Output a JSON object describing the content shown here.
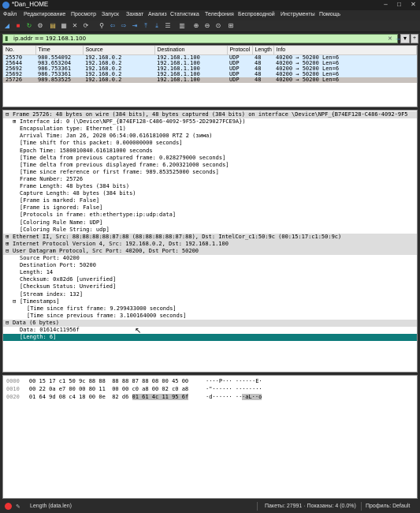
{
  "window": {
    "title": "*Dan_HOME",
    "minimize": "–",
    "maximize": "□",
    "close": "✕"
  },
  "menu": [
    "Файл",
    "Редактирование",
    "Просмотр",
    "Запуск",
    "Захват",
    "Анализ",
    "Статистика",
    "Телефония",
    "Беспроводной",
    "Инструменты",
    "Помощь"
  ],
  "toolbar": {
    "icons": [
      "shark-fin-start-icon",
      "stop-icon",
      "restart-icon",
      "options-gear-icon",
      "open-file-icon",
      "save-icon",
      "close-file-icon",
      "reload-icon",
      "find-icon",
      "back-icon",
      "forward-icon",
      "go-to-packet-icon",
      "first-packet-icon",
      "last-packet-icon",
      "autoscroll-icon",
      "colorize-icon",
      "zoom-in-icon",
      "zoom-out-icon",
      "zoom-reset-icon",
      "resize-columns-icon"
    ]
  },
  "filter": {
    "value": "ip.addr == 192.168.1.100",
    "apply_label": "→",
    "add_label": "+"
  },
  "packet_list": {
    "columns": [
      "No.",
      "Time",
      "Source",
      "Destination",
      "Protocol",
      "Length",
      "Info"
    ],
    "rows": [
      [
        "25570",
        "980.554092",
        "192.168.0.2",
        "192.168.1.100",
        "UDP",
        "48",
        "40200 → 50200 Len=6"
      ],
      [
        "25644",
        "983.653204",
        "192.168.0.2",
        "192.168.1.100",
        "UDP",
        "48",
        "40200 → 50200 Len=6"
      ],
      [
        "25692",
        "986.753361",
        "192.168.0.2",
        "192.168.1.100",
        "UDP",
        "48",
        "40200 → 50200 Len=6"
      ],
      [
        "25692",
        "986.753361",
        "192.168.0.2",
        "192.168.1.100",
        "UDP",
        "48",
        "40200 → 50200 Len=6"
      ],
      [
        "25726",
        "989.853525",
        "192.168.0.2",
        "192.168.1.100",
        "UDP",
        "48",
        "40200 → 50200 Len=6"
      ]
    ],
    "selected_index": 4
  },
  "details": [
    {
      "indent": 0,
      "exp": "⊟",
      "text": "Frame 25726: 48 bytes on wire (384 bits), 48 bytes captured (384 bits) on interface \\Device\\NPF_{B74EF128-C486-4092-9F5",
      "style": "hdr"
    },
    {
      "indent": 1,
      "exp": "⊞",
      "text": "Interface id: 0 (\\Device\\NPF_{B74EF128-C486-4092-9F55-2D29027FCE9A})"
    },
    {
      "indent": 1,
      "exp": "",
      "text": "Encapsulation type: Ethernet (1)"
    },
    {
      "indent": 1,
      "exp": "",
      "text": "Arrival Time: Jan 26, 2020 06:54:00.616181000 RTZ 2 (зима)"
    },
    {
      "indent": 1,
      "exp": "",
      "text": "[Time shift for this packet: 0.000000000 seconds]"
    },
    {
      "indent": 1,
      "exp": "",
      "text": "Epoch Time: 1580010840.616181000 seconds"
    },
    {
      "indent": 1,
      "exp": "",
      "text": "[Time delta from previous captured frame: 0.028279000 seconds]"
    },
    {
      "indent": 1,
      "exp": "",
      "text": "[Time delta from previous displayed frame: 6.200321000 seconds]"
    },
    {
      "indent": 1,
      "exp": "",
      "text": "[Time since reference or first frame: 989.853525000 seconds]"
    },
    {
      "indent": 1,
      "exp": "",
      "text": "Frame Number: 25726"
    },
    {
      "indent": 1,
      "exp": "",
      "text": "Frame Length: 48 bytes (384 bits)"
    },
    {
      "indent": 1,
      "exp": "",
      "text": "Capture Length: 48 bytes (384 bits)"
    },
    {
      "indent": 1,
      "exp": "",
      "text": "[Frame is marked: False]"
    },
    {
      "indent": 1,
      "exp": "",
      "text": "[Frame is ignored: False]"
    },
    {
      "indent": 1,
      "exp": "",
      "text": "[Protocols in frame: eth:ethertype:ip:udp:data]"
    },
    {
      "indent": 1,
      "exp": "",
      "text": "[Coloring Rule Name: UDP]"
    },
    {
      "indent": 1,
      "exp": "",
      "text": "[Coloring Rule String: udp]"
    },
    {
      "indent": 0,
      "exp": "⊞",
      "text": "Ethernet II, Src: 88:88:88:88:87:88 (88:88:88:88:87:88), Dst: IntelCor_c1:50:9c (00:15:17:c1:50:9c)",
      "style": "hdr"
    },
    {
      "indent": 0,
      "exp": "⊞",
      "text": "Internet Protocol Version 4, Src: 192.168.0.2, Dst: 192.168.1.100",
      "style": "hdr"
    },
    {
      "indent": 0,
      "exp": "⊟",
      "text": "User Datagram Protocol, Src Port: 40200, Dst Port: 50200",
      "style": "hdr"
    },
    {
      "indent": 1,
      "exp": "",
      "text": "Source Port: 40200"
    },
    {
      "indent": 1,
      "exp": "",
      "text": "Destination Port: 50200"
    },
    {
      "indent": 1,
      "exp": "",
      "text": "Length: 14"
    },
    {
      "indent": 1,
      "exp": "",
      "text": "Checksum: 0x82d6 [unverified]"
    },
    {
      "indent": 1,
      "exp": "",
      "text": "[Checksum Status: Unverified]"
    },
    {
      "indent": 1,
      "exp": "",
      "text": "[Stream index: 132]"
    },
    {
      "indent": 1,
      "exp": "⊟",
      "text": "[Timestamps]"
    },
    {
      "indent": 2,
      "exp": "",
      "text": "[Time since first frame: 9.299433000 seconds]"
    },
    {
      "indent": 2,
      "exp": "",
      "text": "[Time since previous frame: 3.100164000 seconds]"
    },
    {
      "indent": 0,
      "exp": "⊟",
      "text": "Data (6 bytes)",
      "style": "hdr"
    },
    {
      "indent": 1,
      "exp": "",
      "text": "Data: 01614c11956f"
    },
    {
      "indent": 1,
      "exp": "",
      "text": "[Length: 6]",
      "style": "sel"
    }
  ],
  "bytes": [
    {
      "offset": "0000",
      "hex_a": "00 15 17 c1 50 9c 88 88  88 88 87 88 08 00 45 00",
      "hex_b": "",
      "ascii_a": "····P··· ······E·",
      "ascii_b": ""
    },
    {
      "offset": "0010",
      "hex_a": "00 22 0a e7 00 00 80 11  00 00 c0 a8 00 02 c0 a8",
      "hex_b": "",
      "ascii_a": "·\"······ ········",
      "ascii_b": ""
    },
    {
      "offset": "0020",
      "hex_a": "01 64 9d 08 c4 18 00 0e  82 d6 ",
      "hex_b": "01 61 4c 11 95 6f",
      "ascii_a": "·d······ ··",
      "ascii_b": "·aL··o"
    }
  ],
  "status": {
    "field": "Length (data.len)",
    "packets": "Пакеты: 27991 · Показаны: 4 (0.0%)",
    "profile": "Профиль: Default"
  }
}
